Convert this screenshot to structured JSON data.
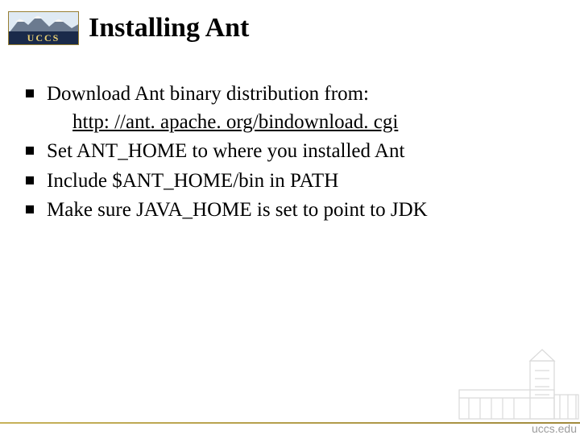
{
  "logo": {
    "text": "UCCS"
  },
  "title": "Installing Ant",
  "bullets": [
    {
      "text": "Download Ant binary distribution from:",
      "link": "http: //ant. apache. org/bindownload. cgi"
    },
    {
      "text": "Set ANT_HOME to where you installed Ant"
    },
    {
      "text": "Include $ANT_HOME/bin in PATH"
    },
    {
      "text": "Make sure JAVA_HOME is set to point to JDK"
    }
  ],
  "footer": {
    "site": "uccs.edu"
  }
}
